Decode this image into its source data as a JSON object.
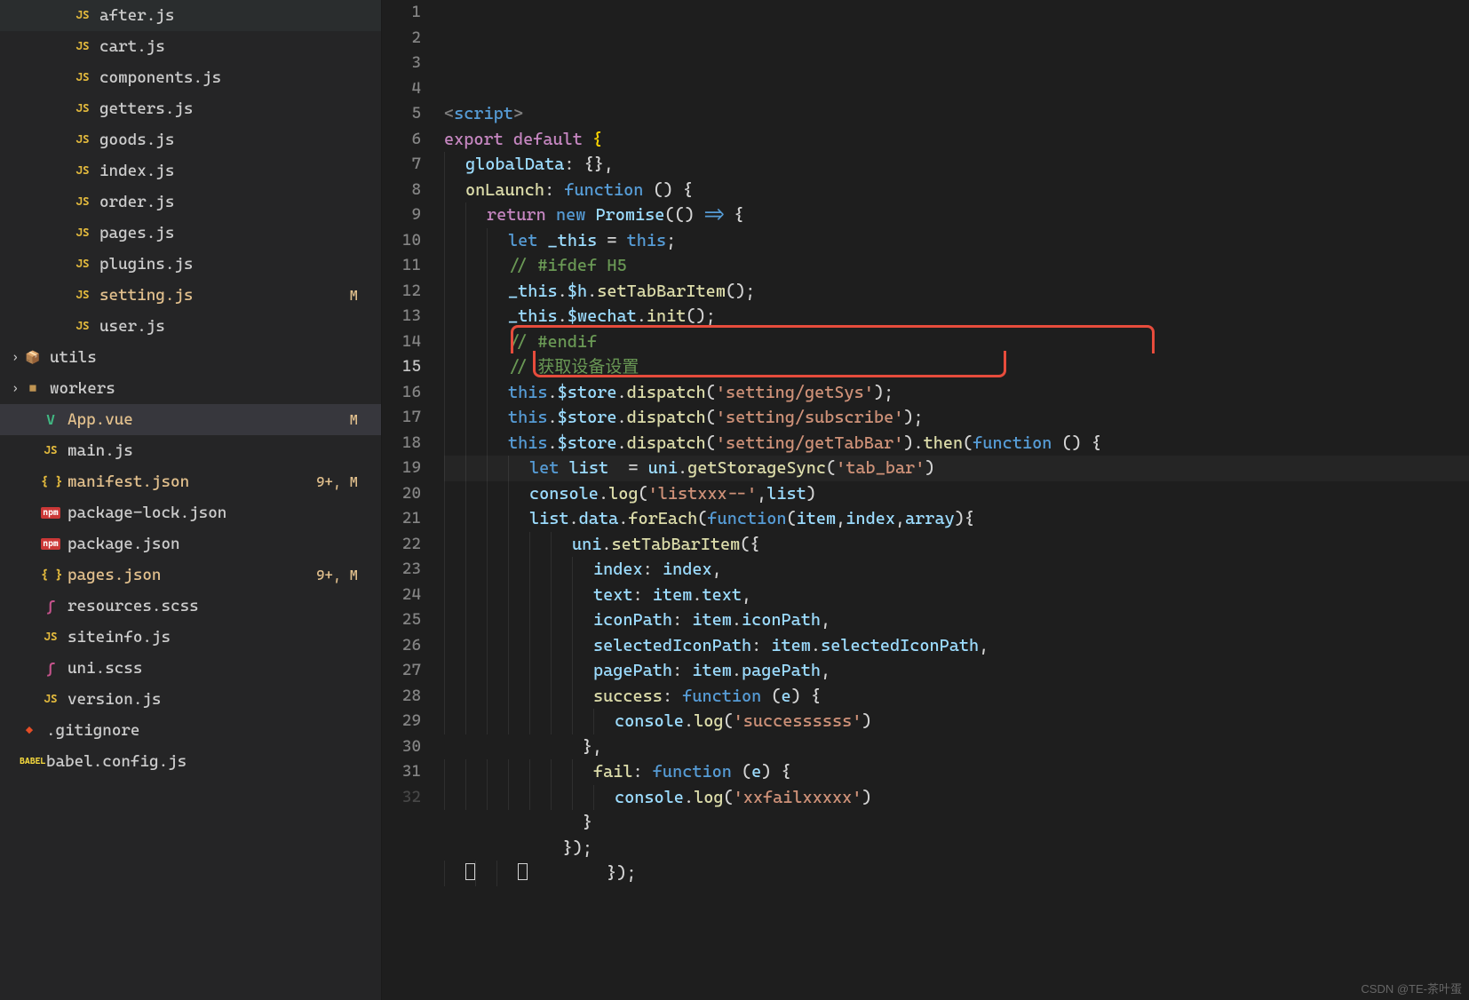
{
  "sidebar": {
    "items": [
      {
        "icon": "JS",
        "iconClass": "icon-js",
        "name": "after.js",
        "indent": 2
      },
      {
        "icon": "JS",
        "iconClass": "icon-js",
        "name": "cart.js",
        "indent": 2
      },
      {
        "icon": "JS",
        "iconClass": "icon-js",
        "name": "components.js",
        "indent": 2
      },
      {
        "icon": "JS",
        "iconClass": "icon-js",
        "name": "getters.js",
        "indent": 2
      },
      {
        "icon": "JS",
        "iconClass": "icon-js",
        "name": "goods.js",
        "indent": 2
      },
      {
        "icon": "JS",
        "iconClass": "icon-js",
        "name": "index.js",
        "indent": 2
      },
      {
        "icon": "JS",
        "iconClass": "icon-js",
        "name": "order.js",
        "indent": 2
      },
      {
        "icon": "JS",
        "iconClass": "icon-js",
        "name": "pages.js",
        "indent": 2
      },
      {
        "icon": "JS",
        "iconClass": "icon-js",
        "name": "plugins.js",
        "indent": 2
      },
      {
        "icon": "JS",
        "iconClass": "icon-js",
        "name": "setting.js",
        "indent": 2,
        "status": "M",
        "modified": true
      },
      {
        "icon": "JS",
        "iconClass": "icon-js",
        "name": "user.js",
        "indent": 2
      },
      {
        "chevron": "›",
        "icon": "📦",
        "iconClass": "icon-folder",
        "name": "utils",
        "indent": 0,
        "folder": true
      },
      {
        "chevron": "›",
        "icon": "■",
        "iconClass": "icon-folder",
        "name": "workers",
        "indent": 0,
        "folder": true
      },
      {
        "icon": "V",
        "iconClass": "icon-vue",
        "name": "App.vue",
        "indent": 1,
        "status": "M",
        "modified": true,
        "selected": true
      },
      {
        "icon": "JS",
        "iconClass": "icon-js",
        "name": "main.js",
        "indent": 1
      },
      {
        "icon": "{ }",
        "iconClass": "icon-json",
        "name": "manifest.json",
        "indent": 1,
        "status": "9+, M",
        "modified": true
      },
      {
        "icon": "npm",
        "iconClass": "icon-npm",
        "name": "package-lock.json",
        "indent": 1
      },
      {
        "icon": "npm",
        "iconClass": "icon-npm",
        "name": "package.json",
        "indent": 1
      },
      {
        "icon": "{ }",
        "iconClass": "icon-json",
        "name": "pages.json",
        "indent": 1,
        "status": "9+, M",
        "modified": true
      },
      {
        "icon": "ʃ",
        "iconClass": "icon-scss",
        "name": "resources.scss",
        "indent": 1
      },
      {
        "icon": "JS",
        "iconClass": "icon-js",
        "name": "siteinfo.js",
        "indent": 1
      },
      {
        "icon": "ʃ",
        "iconClass": "icon-scss",
        "name": "uni.scss",
        "indent": 1
      },
      {
        "icon": "JS",
        "iconClass": "icon-js",
        "name": "version.js",
        "indent": 1
      },
      {
        "icon": "◆",
        "iconClass": "icon-git",
        "name": ".gitignore",
        "indent": 0,
        "rootfile": true
      },
      {
        "icon": "BABEL",
        "iconClass": "icon-babel",
        "name": "babel.config.js",
        "indent": 0,
        "rootfile": true
      }
    ]
  },
  "editor": {
    "activeLine": 15,
    "lines": {
      "1": {
        "tokens": [
          {
            "t": "<",
            "c": "tk-tag"
          },
          {
            "t": "script",
            "c": "tk-keyword2"
          },
          {
            "t": ">",
            "c": "tk-tag"
          }
        ]
      },
      "2": {
        "tokens": [
          {
            "t": "export default",
            "c": "tk-keyword"
          },
          {
            "t": " {",
            "c": "tk-brace"
          }
        ]
      },
      "3": {
        "tokens": [
          {
            "t": "  ",
            "c": ""
          },
          {
            "t": "globalData",
            "c": "tk-var"
          },
          {
            "t": ": {},",
            "c": "tk-punct"
          }
        ]
      },
      "4": {
        "tokens": [
          {
            "t": "  ",
            "c": ""
          },
          {
            "t": "onLaunch",
            "c": "tk-func"
          },
          {
            "t": ": ",
            "c": "tk-punct"
          },
          {
            "t": "function",
            "c": "tk-keyword2"
          },
          {
            "t": " () {",
            "c": "tk-punct"
          }
        ]
      },
      "5": {
        "tokens": [
          {
            "t": "    ",
            "c": ""
          },
          {
            "t": "return",
            "c": "tk-keyword"
          },
          {
            "t": " ",
            "c": ""
          },
          {
            "t": "new",
            "c": "tk-keyword2"
          },
          {
            "t": " ",
            "c": ""
          },
          {
            "t": "Promise",
            "c": "tk-var"
          },
          {
            "t": "(() ",
            "c": "tk-punct"
          },
          {
            "t": "=>",
            "c": "tk-keyword2"
          },
          {
            "t": " {",
            "c": "tk-punct"
          }
        ]
      },
      "6": {
        "tokens": [
          {
            "t": "      ",
            "c": ""
          },
          {
            "t": "let",
            "c": "tk-keyword2"
          },
          {
            "t": " ",
            "c": ""
          },
          {
            "t": "_this",
            "c": "tk-var"
          },
          {
            "t": " = ",
            "c": "tk-punct"
          },
          {
            "t": "this",
            "c": "tk-this"
          },
          {
            "t": ";",
            "c": "tk-punct"
          }
        ]
      },
      "7": {
        "tokens": [
          {
            "t": "      ",
            "c": ""
          },
          {
            "t": "// #ifdef H5",
            "c": "tk-comment"
          }
        ]
      },
      "8": {
        "tokens": [
          {
            "t": "      ",
            "c": ""
          },
          {
            "t": "_this",
            "c": "tk-var"
          },
          {
            "t": ".",
            "c": "tk-punct"
          },
          {
            "t": "$h",
            "c": "tk-var"
          },
          {
            "t": ".",
            "c": "tk-punct"
          },
          {
            "t": "setTabBarItem",
            "c": "tk-func"
          },
          {
            "t": "();",
            "c": "tk-punct"
          }
        ]
      },
      "9": {
        "tokens": [
          {
            "t": "      ",
            "c": ""
          },
          {
            "t": "_this",
            "c": "tk-var"
          },
          {
            "t": ".",
            "c": "tk-punct"
          },
          {
            "t": "$wechat",
            "c": "tk-var"
          },
          {
            "t": ".",
            "c": "tk-punct"
          },
          {
            "t": "init",
            "c": "tk-func"
          },
          {
            "t": "();",
            "c": "tk-punct"
          }
        ]
      },
      "10": {
        "tokens": [
          {
            "t": "      ",
            "c": ""
          },
          {
            "t": "// #endif",
            "c": "tk-comment"
          }
        ]
      },
      "11": {
        "tokens": [
          {
            "t": "      ",
            "c": ""
          },
          {
            "t": "// 获取设备设置",
            "c": "tk-comment"
          }
        ]
      },
      "12": {
        "tokens": [
          {
            "t": "      ",
            "c": ""
          },
          {
            "t": "this",
            "c": "tk-this"
          },
          {
            "t": ".",
            "c": "tk-punct"
          },
          {
            "t": "$store",
            "c": "tk-var"
          },
          {
            "t": ".",
            "c": "tk-punct"
          },
          {
            "t": "dispatch",
            "c": "tk-func"
          },
          {
            "t": "(",
            "c": "tk-punct"
          },
          {
            "t": "'setting/getSys'",
            "c": "tk-string"
          },
          {
            "t": ");",
            "c": "tk-punct"
          }
        ]
      },
      "13": {
        "tokens": [
          {
            "t": "      ",
            "c": ""
          },
          {
            "t": "this",
            "c": "tk-this"
          },
          {
            "t": ".",
            "c": "tk-punct"
          },
          {
            "t": "$store",
            "c": "tk-var"
          },
          {
            "t": ".",
            "c": "tk-punct"
          },
          {
            "t": "dispatch",
            "c": "tk-func"
          },
          {
            "t": "(",
            "c": "tk-punct"
          },
          {
            "t": "'setting/subscribe'",
            "c": "tk-string"
          },
          {
            "t": ");",
            "c": "tk-punct"
          }
        ]
      },
      "14": {
        "tokens": [
          {
            "t": "      ",
            "c": ""
          },
          {
            "t": "this",
            "c": "tk-this"
          },
          {
            "t": ".",
            "c": "tk-punct"
          },
          {
            "t": "$store",
            "c": "tk-var"
          },
          {
            "t": ".",
            "c": "tk-punct"
          },
          {
            "t": "dispatch",
            "c": "tk-func"
          },
          {
            "t": "(",
            "c": "tk-punct"
          },
          {
            "t": "'setting/getTabBar'",
            "c": "tk-string"
          },
          {
            "t": ").",
            "c": "tk-punct"
          },
          {
            "t": "then",
            "c": "tk-func"
          },
          {
            "t": "(",
            "c": "tk-punct"
          },
          {
            "t": "function",
            "c": "tk-keyword2"
          },
          {
            "t": " () {",
            "c": "tk-punct"
          }
        ]
      },
      "15": {
        "tokens": [
          {
            "t": "        ",
            "c": ""
          },
          {
            "t": "let",
            "c": "tk-keyword2"
          },
          {
            "t": " ",
            "c": ""
          },
          {
            "t": "list",
            "c": "tk-var"
          },
          {
            "t": "  = ",
            "c": "tk-punct"
          },
          {
            "t": "uni",
            "c": "tk-var"
          },
          {
            "t": ".",
            "c": "tk-punct"
          },
          {
            "t": "getStorageSync",
            "c": "tk-func"
          },
          {
            "t": "(",
            "c": "tk-punct"
          },
          {
            "t": "'tab_bar'",
            "c": "tk-string"
          },
          {
            "t": ")",
            "c": "tk-punct"
          }
        ]
      },
      "16": {
        "tokens": [
          {
            "t": "        ",
            "c": ""
          },
          {
            "t": "console",
            "c": "tk-var"
          },
          {
            "t": ".",
            "c": "tk-punct"
          },
          {
            "t": "log",
            "c": "tk-func"
          },
          {
            "t": "(",
            "c": "tk-punct"
          },
          {
            "t": "'listxxx--'",
            "c": "tk-string"
          },
          {
            "t": ",",
            "c": "tk-punct"
          },
          {
            "t": "list",
            "c": "tk-var"
          },
          {
            "t": ")",
            "c": "tk-punct"
          }
        ]
      },
      "17": {
        "tokens": [
          {
            "t": "        ",
            "c": ""
          },
          {
            "t": "list",
            "c": "tk-var"
          },
          {
            "t": ".",
            "c": "tk-punct"
          },
          {
            "t": "data",
            "c": "tk-var"
          },
          {
            "t": ".",
            "c": "tk-punct"
          },
          {
            "t": "forEach",
            "c": "tk-func"
          },
          {
            "t": "(",
            "c": "tk-punct"
          },
          {
            "t": "function",
            "c": "tk-keyword2"
          },
          {
            "t": "(",
            "c": "tk-punct"
          },
          {
            "t": "item",
            "c": "tk-var"
          },
          {
            "t": ",",
            "c": "tk-punct"
          },
          {
            "t": "index",
            "c": "tk-var"
          },
          {
            "t": ",",
            "c": "tk-punct"
          },
          {
            "t": "array",
            "c": "tk-var"
          },
          {
            "t": "){",
            "c": "tk-punct"
          }
        ]
      },
      "18": {
        "tokens": [
          {
            "t": "            ",
            "c": ""
          },
          {
            "t": "uni",
            "c": "tk-var"
          },
          {
            "t": ".",
            "c": "tk-punct"
          },
          {
            "t": "setTabBarItem",
            "c": "tk-func"
          },
          {
            "t": "({",
            "c": "tk-punct"
          }
        ]
      },
      "19": {
        "tokens": [
          {
            "t": "              ",
            "c": ""
          },
          {
            "t": "index",
            "c": "tk-var"
          },
          {
            "t": ": ",
            "c": "tk-punct"
          },
          {
            "t": "index",
            "c": "tk-var"
          },
          {
            "t": ",",
            "c": "tk-punct"
          }
        ]
      },
      "20": {
        "tokens": [
          {
            "t": "              ",
            "c": ""
          },
          {
            "t": "text",
            "c": "tk-var"
          },
          {
            "t": ": ",
            "c": "tk-punct"
          },
          {
            "t": "item",
            "c": "tk-var"
          },
          {
            "t": ".",
            "c": "tk-punct"
          },
          {
            "t": "text",
            "c": "tk-var"
          },
          {
            "t": ",",
            "c": "tk-punct"
          }
        ]
      },
      "21": {
        "tokens": [
          {
            "t": "              ",
            "c": ""
          },
          {
            "t": "iconPath",
            "c": "tk-var"
          },
          {
            "t": ": ",
            "c": "tk-punct"
          },
          {
            "t": "item",
            "c": "tk-var"
          },
          {
            "t": ".",
            "c": "tk-punct"
          },
          {
            "t": "iconPath",
            "c": "tk-var"
          },
          {
            "t": ",",
            "c": "tk-punct"
          }
        ]
      },
      "22": {
        "tokens": [
          {
            "t": "              ",
            "c": ""
          },
          {
            "t": "selectedIconPath",
            "c": "tk-var"
          },
          {
            "t": ": ",
            "c": "tk-punct"
          },
          {
            "t": "item",
            "c": "tk-var"
          },
          {
            "t": ".",
            "c": "tk-punct"
          },
          {
            "t": "selectedIconPath",
            "c": "tk-var"
          },
          {
            "t": ",",
            "c": "tk-punct"
          }
        ]
      },
      "23": {
        "tokens": [
          {
            "t": "              ",
            "c": ""
          },
          {
            "t": "pagePath",
            "c": "tk-var"
          },
          {
            "t": ": ",
            "c": "tk-punct"
          },
          {
            "t": "item",
            "c": "tk-var"
          },
          {
            "t": ".",
            "c": "tk-punct"
          },
          {
            "t": "pagePath",
            "c": "tk-var"
          },
          {
            "t": ",",
            "c": "tk-punct"
          }
        ]
      },
      "24": {
        "tokens": [
          {
            "t": "              ",
            "c": ""
          },
          {
            "t": "success",
            "c": "tk-func"
          },
          {
            "t": ": ",
            "c": "tk-punct"
          },
          {
            "t": "function",
            "c": "tk-keyword2"
          },
          {
            "t": " (",
            "c": "tk-punct"
          },
          {
            "t": "e",
            "c": "tk-var"
          },
          {
            "t": ") {",
            "c": "tk-punct"
          }
        ]
      },
      "25": {
        "tokens": [
          {
            "t": "                ",
            "c": ""
          },
          {
            "t": "console",
            "c": "tk-var"
          },
          {
            "t": ".",
            "c": "tk-punct"
          },
          {
            "t": "log",
            "c": "tk-func"
          },
          {
            "t": "(",
            "c": "tk-punct"
          },
          {
            "t": "'successssss'",
            "c": "tk-string"
          },
          {
            "t": ")",
            "c": "tk-punct"
          }
        ]
      },
      "26": {
        "tokens": [
          {
            "t": "              },",
            "c": "tk-punct"
          }
        ]
      },
      "27": {
        "tokens": [
          {
            "t": "              ",
            "c": ""
          },
          {
            "t": "fail",
            "c": "tk-func"
          },
          {
            "t": ": ",
            "c": "tk-punct"
          },
          {
            "t": "function",
            "c": "tk-keyword2"
          },
          {
            "t": " (",
            "c": "tk-punct"
          },
          {
            "t": "e",
            "c": "tk-var"
          },
          {
            "t": ") {",
            "c": "tk-punct"
          }
        ]
      },
      "28": {
        "tokens": [
          {
            "t": "                ",
            "c": ""
          },
          {
            "t": "console",
            "c": "tk-var"
          },
          {
            "t": ".",
            "c": "tk-punct"
          },
          {
            "t": "log",
            "c": "tk-func"
          },
          {
            "t": "(",
            "c": "tk-punct"
          },
          {
            "t": "'xxfailxxxxx'",
            "c": "tk-string"
          },
          {
            "t": ")",
            "c": "tk-punct"
          }
        ]
      },
      "29": {
        "tokens": [
          {
            "t": "              }",
            "c": "tk-punct"
          }
        ]
      },
      "30": {
        "tokens": [
          {
            "t": "            });",
            "c": "tk-punct"
          }
        ]
      },
      "31": {
        "tokens": [
          {
            "t": "        });",
            "c": "tk-punct"
          }
        ]
      }
    }
  },
  "watermark": "CSDN @TE-茶叶蛋"
}
